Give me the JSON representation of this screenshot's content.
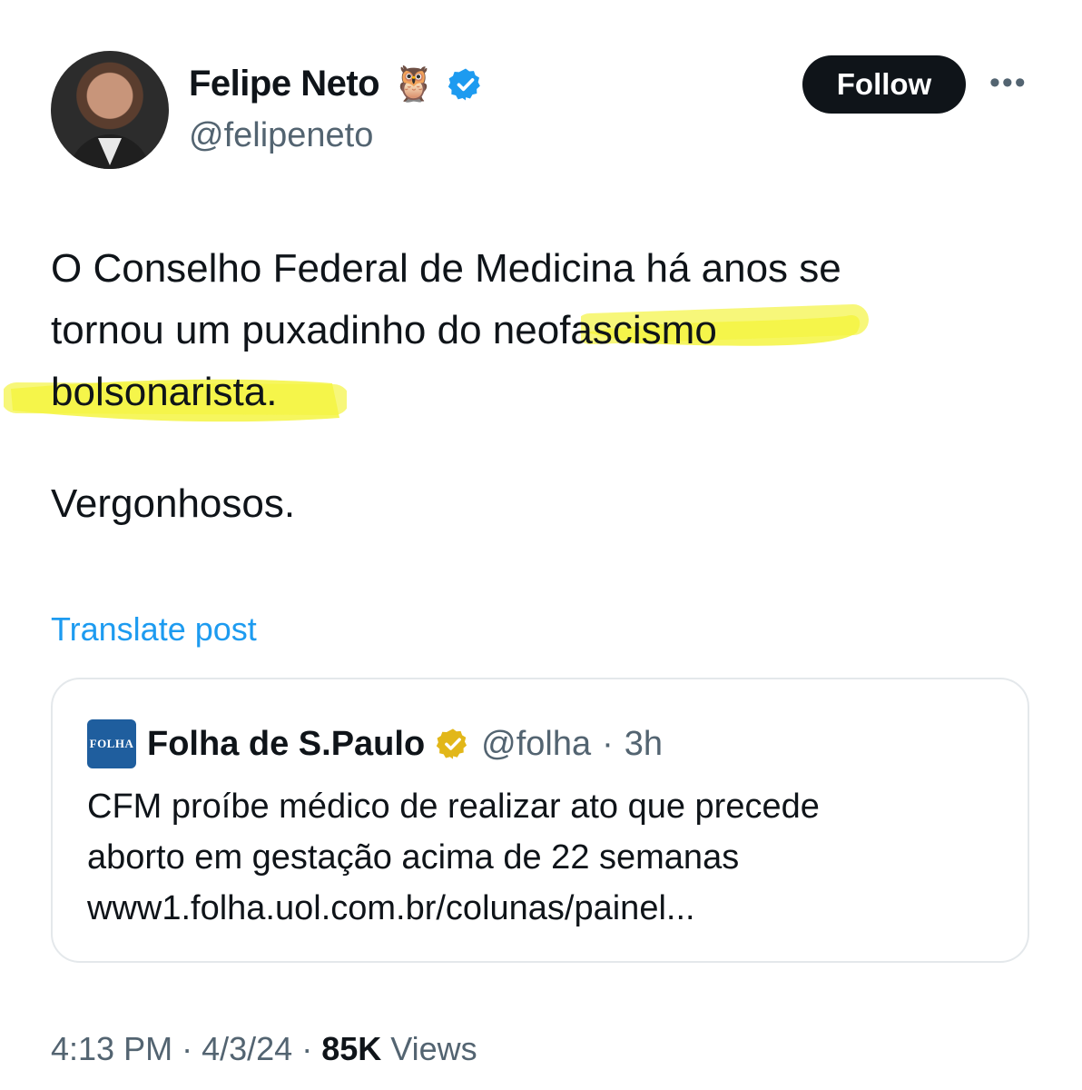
{
  "author": {
    "display_name": "Felipe Neto",
    "emoji": "🦉",
    "handle": "@felipeneto",
    "verified_color": "#1d9bf0"
  },
  "actions": {
    "follow_label": "Follow",
    "more_label": "•••"
  },
  "post": {
    "lines": [
      "O Conselho Federal de Medicina há anos se",
      "tornou um puxadinho do neofascismo",
      "bolsonarista."
    ],
    "closing": "Vergonhosos.",
    "highlight_color": "#f5f542"
  },
  "translate_label": "Translate post",
  "quoted": {
    "logo_text": "FOLHA",
    "name": "Folha de S.Paulo",
    "verified_color": "#e2b719",
    "handle": "@folha",
    "separator": "·",
    "time": "3h",
    "lines": [
      "CFM proíbe médico de realizar ato que precede",
      "aborto em gestação acima de 22 semanas",
      "www1.folha.uol.com.br/colunas/painel..."
    ]
  },
  "meta": {
    "time": "4:13 PM",
    "sep1": "·",
    "date": "4/3/24",
    "sep2": "·",
    "views_count": "85K",
    "views_label": "Views"
  }
}
